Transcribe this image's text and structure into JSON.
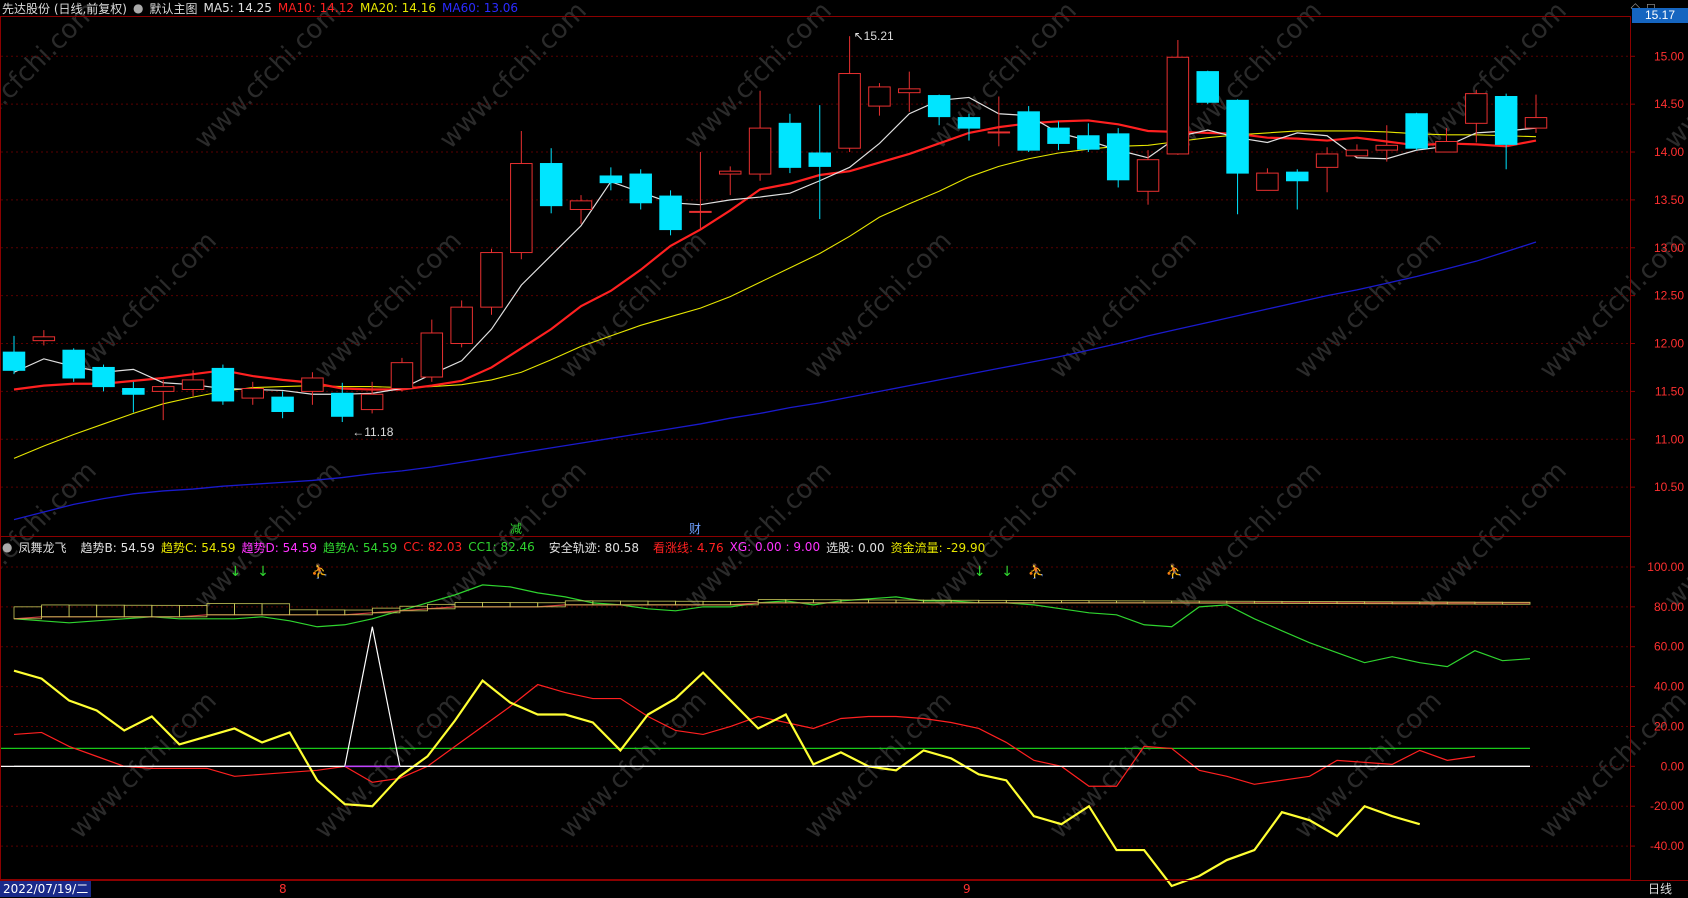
{
  "colors": {
    "bg": "#000000",
    "frame": "#8b0000",
    "grid": "#5a0000",
    "up": "#e83030",
    "down": "#00e5ff",
    "ma5": "#e0e0e0",
    "ma10": "#ff2020",
    "ma20": "#e6e600",
    "ma60": "#1a1acc",
    "text": "#dddddd"
  },
  "header": {
    "title": "先达股份 (日线,前复权)",
    "main_chart": "默认主图",
    "ma5": "MA5: 14.25",
    "ma10": "MA10: 14.12",
    "ma20": "MA20: 14.16",
    "ma60": "MA60: 13.06"
  },
  "indicator_header": {
    "name": "凤舞龙飞",
    "b": "趋势B: 54.59",
    "c": "趋势C: 54.59",
    "d": "趋势D: 54.59",
    "a": "趋势A: 54.59",
    "cc": "CC: 82.03",
    "cc1": "CC1: 82.46",
    "safe": "安全轨迹: 80.58",
    "rise": "看涨线: 4.76",
    "xg": "XG: 0.00 : 9.00",
    "pick": "选股: 0.00",
    "flow": "资金流量: -29.90"
  },
  "current_price": "15.17",
  "price_axis": {
    "labels": [
      "15.00",
      "14.50",
      "14.00",
      "13.50",
      "13.00",
      "12.50",
      "12.00",
      "11.50",
      "11.00",
      "10.50"
    ],
    "values": [
      15.0,
      14.5,
      14.0,
      13.5,
      13.0,
      12.5,
      12.0,
      11.5,
      11.0,
      10.5
    ]
  },
  "ind_axis": {
    "labels": [
      "100.00",
      "80.00",
      "60.00",
      "40.00",
      "20.00",
      "0.00",
      "-20.00",
      "-40.00"
    ],
    "values": [
      100,
      80,
      60,
      40,
      20,
      0,
      -20,
      -40
    ]
  },
  "annotations": {
    "high": "15.21",
    "low": "11.18",
    "jian": "减",
    "cai": "财"
  },
  "bottom": {
    "date": "2022/07/19/二",
    "m8": "8",
    "m9": "9",
    "period": "日线"
  },
  "watermark": "www.cfchi.com",
  "chart_data": [
    {
      "type": "candlestick",
      "title": "先达股份 (日线,前复权)",
      "candles": [
        [
          11.91,
          11.72,
          12.08,
          11.68
        ],
        [
          12.03,
          12.07,
          12.14,
          11.98
        ],
        [
          11.93,
          11.64,
          11.95,
          11.6
        ],
        [
          11.75,
          11.55,
          11.78,
          11.5
        ],
        [
          11.53,
          11.47,
          11.6,
          11.28
        ],
        [
          11.5,
          11.55,
          11.62,
          11.2
        ],
        [
          11.52,
          11.62,
          11.72,
          11.45
        ],
        [
          11.74,
          11.4,
          11.78,
          11.36
        ],
        [
          11.43,
          11.53,
          11.6,
          11.36
        ],
        [
          11.44,
          11.29,
          11.5,
          11.22
        ],
        [
          11.5,
          11.64,
          11.7,
          11.36
        ],
        [
          11.48,
          11.24,
          11.59,
          11.18
        ],
        [
          11.31,
          11.47,
          11.6,
          11.27
        ],
        [
          11.53,
          11.8,
          11.85,
          11.5
        ],
        [
          11.65,
          12.11,
          12.25,
          11.6
        ],
        [
          12.0,
          12.38,
          12.45,
          11.96
        ],
        [
          12.38,
          12.95,
          12.99,
          12.3
        ],
        [
          12.95,
          13.88,
          14.22,
          12.88
        ],
        [
          13.88,
          13.44,
          14.04,
          13.36
        ],
        [
          13.4,
          13.49,
          13.55,
          13.25
        ],
        [
          13.75,
          13.68,
          13.84,
          13.6
        ],
        [
          13.77,
          13.47,
          13.82,
          13.4
        ],
        [
          13.54,
          13.19,
          13.6,
          13.13
        ],
        [
          13.37,
          13.38,
          14.0,
          13.2
        ],
        [
          13.77,
          13.8,
          13.85,
          13.55
        ],
        [
          13.77,
          14.25,
          14.64,
          13.7
        ],
        [
          14.3,
          13.84,
          14.4,
          13.78
        ],
        [
          13.99,
          13.85,
          14.49,
          13.3
        ],
        [
          14.04,
          14.82,
          15.21,
          14.0
        ],
        [
          14.48,
          14.68,
          14.72,
          14.38
        ],
        [
          14.62,
          14.66,
          14.84,
          14.42
        ],
        [
          14.59,
          14.37,
          14.6,
          14.28
        ],
        [
          14.36,
          14.25,
          14.4,
          14.12
        ],
        [
          14.21,
          14.21,
          14.58,
          14.06
        ],
        [
          14.42,
          14.02,
          14.48,
          14.0
        ],
        [
          14.25,
          14.09,
          14.32,
          14.02
        ],
        [
          14.17,
          14.03,
          14.3,
          14.0
        ],
        [
          14.19,
          13.71,
          14.25,
          13.63
        ],
        [
          13.59,
          13.92,
          14.02,
          13.45
        ],
        [
          13.98,
          14.99,
          15.17,
          13.97
        ],
        [
          14.84,
          14.52,
          14.85,
          14.5
        ],
        [
          14.54,
          13.78,
          14.55,
          13.35
        ],
        [
          13.6,
          13.78,
          13.83,
          13.63
        ],
        [
          13.79,
          13.7,
          13.82,
          13.4
        ],
        [
          13.84,
          13.98,
          14.05,
          13.58
        ],
        [
          13.96,
          14.02,
          14.08,
          13.95
        ],
        [
          14.02,
          14.07,
          14.28,
          13.9
        ],
        [
          14.4,
          14.04,
          14.41,
          14.02
        ],
        [
          14.0,
          14.11,
          14.25,
          14.0
        ],
        [
          14.3,
          14.61,
          14.65,
          14.1
        ],
        [
          14.58,
          14.08,
          14.61,
          13.82
        ],
        [
          14.25,
          14.36,
          14.6,
          14.2
        ]
      ],
      "ma5": [
        11.7,
        11.84,
        11.76,
        11.7,
        11.73,
        11.59,
        11.57,
        11.53,
        11.52,
        11.51,
        11.47,
        11.47,
        11.48,
        11.53,
        11.68,
        11.82,
        12.15,
        12.61,
        12.92,
        13.23,
        13.69,
        13.58,
        13.47,
        13.45,
        13.5,
        13.53,
        13.57,
        13.7,
        13.84,
        14.09,
        14.4,
        14.54,
        14.57,
        14.4,
        14.38,
        14.2,
        14.12,
        14.02,
        13.94,
        14.16,
        14.23,
        14.15,
        14.1,
        14.2,
        14.17,
        13.94,
        13.93,
        14.02,
        14.06,
        14.2,
        14.22,
        14.25
      ],
      "ma10": [
        11.52,
        11.56,
        11.58,
        11.58,
        11.61,
        11.64,
        11.68,
        11.72,
        11.66,
        11.62,
        11.59,
        11.53,
        11.52,
        11.52,
        11.56,
        11.61,
        11.75,
        11.95,
        12.15,
        12.39,
        12.55,
        12.77,
        13.02,
        13.19,
        13.39,
        13.61,
        13.67,
        13.76,
        13.8,
        13.89,
        13.98,
        14.09,
        14.2,
        14.26,
        14.3,
        14.32,
        14.33,
        14.29,
        14.22,
        14.21,
        14.2,
        14.19,
        14.15,
        14.14,
        14.12,
        14.15,
        14.11,
        14.07,
        14.09,
        14.08,
        14.06,
        14.12
      ],
      "ma20": [
        10.8,
        10.93,
        11.05,
        11.16,
        11.27,
        11.37,
        11.44,
        11.5,
        11.54,
        11.55,
        11.56,
        11.55,
        11.55,
        11.54,
        11.55,
        11.57,
        11.62,
        11.7,
        11.83,
        11.97,
        12.08,
        12.19,
        12.28,
        12.37,
        12.49,
        12.64,
        12.79,
        12.94,
        13.12,
        13.32,
        13.46,
        13.59,
        13.74,
        13.85,
        13.93,
        13.99,
        14.03,
        14.06,
        14.07,
        14.11,
        14.15,
        14.18,
        14.2,
        14.22,
        14.22,
        14.22,
        14.21,
        14.19,
        14.18,
        14.18,
        14.17,
        14.16
      ],
      "ma60": [
        10.16,
        10.24,
        10.32,
        10.38,
        10.43,
        10.46,
        10.48,
        10.51,
        10.53,
        10.55,
        10.57,
        10.6,
        10.64,
        10.67,
        10.71,
        10.76,
        10.81,
        10.86,
        10.91,
        10.96,
        11.01,
        11.06,
        11.11,
        11.16,
        11.22,
        11.27,
        11.33,
        11.38,
        11.44,
        11.5,
        11.56,
        11.62,
        11.68,
        11.74,
        11.8,
        11.86,
        11.93,
        12.0,
        12.08,
        12.15,
        12.22,
        12.29,
        12.36,
        12.43,
        12.5,
        12.56,
        12.63,
        12.7,
        12.78,
        12.86,
        12.96,
        13.06
      ],
      "ylim": [
        10.0,
        15.4
      ]
    },
    {
      "type": "line",
      "title": "凤舞龙飞",
      "series": [
        {
          "name": "安全轨迹",
          "color": "#2fd42f",
          "values": [
            74,
            73,
            72,
            73,
            74,
            75,
            74,
            74,
            74,
            75,
            73,
            70,
            71,
            74,
            78,
            82,
            86,
            91,
            90,
            87,
            85,
            82,
            81,
            79,
            78,
            80,
            80,
            82,
            83,
            81,
            83,
            84,
            85,
            83,
            83,
            82,
            82,
            81,
            79,
            77,
            76,
            71,
            70,
            80,
            81,
            74,
            68,
            62,
            57,
            52,
            55,
            52,
            50,
            58,
            53,
            54
          ]
        },
        {
          "name": "CC",
          "color": "#ff2020",
          "values": [
            16,
            17,
            10,
            5,
            0,
            -1,
            -1,
            -1,
            -5,
            -4,
            -3,
            -2,
            0,
            -8,
            -6,
            0,
            10,
            20,
            30,
            41,
            37,
            34,
            34,
            25,
            18,
            16,
            20,
            25,
            22,
            19,
            24,
            25,
            25,
            24,
            22,
            19,
            12,
            3,
            0,
            -10,
            -10,
            10,
            9,
            -2,
            -5,
            -9,
            -7,
            -5,
            3,
            2,
            1,
            8,
            3,
            5
          ]
        },
        {
          "name": "看涨线",
          "color": "#ffff33",
          "values": [
            48,
            44,
            33,
            28,
            18,
            25,
            11,
            15,
            19,
            12,
            17,
            -7,
            -19,
            -20,
            -5,
            5,
            23,
            43,
            32,
            26,
            26,
            22,
            8,
            26,
            34,
            47,
            33,
            19,
            26,
            1,
            7,
            0,
            -2,
            8,
            4,
            -4,
            -7,
            -25,
            -29,
            -20,
            -42,
            -42,
            -60,
            -55,
            -47,
            -42,
            -23,
            -27,
            -35,
            -20,
            -25,
            -29
          ]
        },
        {
          "name": "XG",
          "color": "#ffffff",
          "values": [
            0,
            0,
            0,
            0,
            0,
            0,
            0,
            0,
            0,
            0,
            0,
            0,
            0,
            70,
            0,
            0,
            0,
            0,
            0,
            0,
            0,
            0,
            0,
            0,
            0,
            0,
            0,
            0,
            0,
            0,
            0,
            0,
            0,
            0,
            0,
            0,
            0,
            0,
            0,
            0,
            0,
            0,
            0,
            0,
            0,
            0,
            0,
            0,
            0,
            0,
            0,
            0,
            0,
            0,
            0,
            0
          ]
        },
        {
          "name": "CC1",
          "color": "#d04040",
          "values": [
            74,
            75,
            75,
            75,
            75,
            75,
            75,
            76,
            76,
            76,
            76,
            76,
            76,
            77,
            78,
            79,
            80,
            80,
            80,
            80,
            81,
            81,
            81,
            81,
            81,
            81,
            81,
            82,
            82,
            82,
            82,
            82,
            82,
            82,
            82,
            82,
            82,
            82,
            82,
            82,
            82,
            82,
            82,
            82,
            82,
            82,
            82,
            82,
            82,
            82,
            82,
            82,
            82,
            82,
            82,
            82
          ]
        }
      ],
      "hlines": [
        {
          "y": 9,
          "color": "#19c819"
        },
        {
          "y": 0,
          "color": "#ffffff"
        }
      ],
      "signals": {
        "green_arrows": [
          8,
          9,
          35,
          36
        ],
        "figures": [
          11,
          37,
          42
        ]
      },
      "ylim": [
        -56,
        106
      ]
    }
  ]
}
